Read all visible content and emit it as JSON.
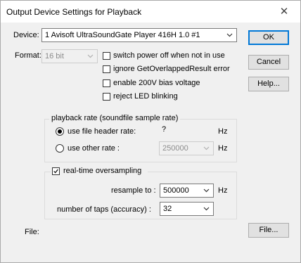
{
  "window": {
    "title": "Output Device Settings for Playback",
    "close_glyph": "✕"
  },
  "device": {
    "label": "Device:",
    "value": "1 Avisoft UltraSoundGate Player 416H 1.0 #1"
  },
  "format": {
    "label": "Format:",
    "value": "16 bit",
    "enabled": false
  },
  "options": [
    {
      "label": "switch power off when not in use",
      "checked": false
    },
    {
      "label": "ignore GetOverlappedResult error",
      "checked": false
    },
    {
      "label": "enable 200V bias voltage",
      "checked": false
    },
    {
      "label": "reject LED blinking",
      "checked": false
    }
  ],
  "buttons": {
    "ok": "OK",
    "cancel": "Cancel",
    "help": "Help...",
    "file": "File..."
  },
  "playback_rate": {
    "group_title": "playback rate (soundfile sample rate)",
    "use_header_label": "use file header rate:",
    "header_rate_value": "?",
    "header_unit": "Hz",
    "use_other_label": "use other rate :",
    "other_rate_value": "250000",
    "other_unit": "Hz",
    "selected": "use_header"
  },
  "oversampling": {
    "label": "real-time oversampling",
    "checked": true,
    "resample_label": "resample to :",
    "resample_value": "500000",
    "resample_unit": "Hz",
    "taps_label": "number of taps (accuracy) :",
    "taps_value": "32"
  },
  "file": {
    "label": "File:"
  },
  "colors": {
    "accent": "#0078d7",
    "dialog_bg": "#f0f0f0",
    "disabled_text": "#8c8c8c"
  }
}
